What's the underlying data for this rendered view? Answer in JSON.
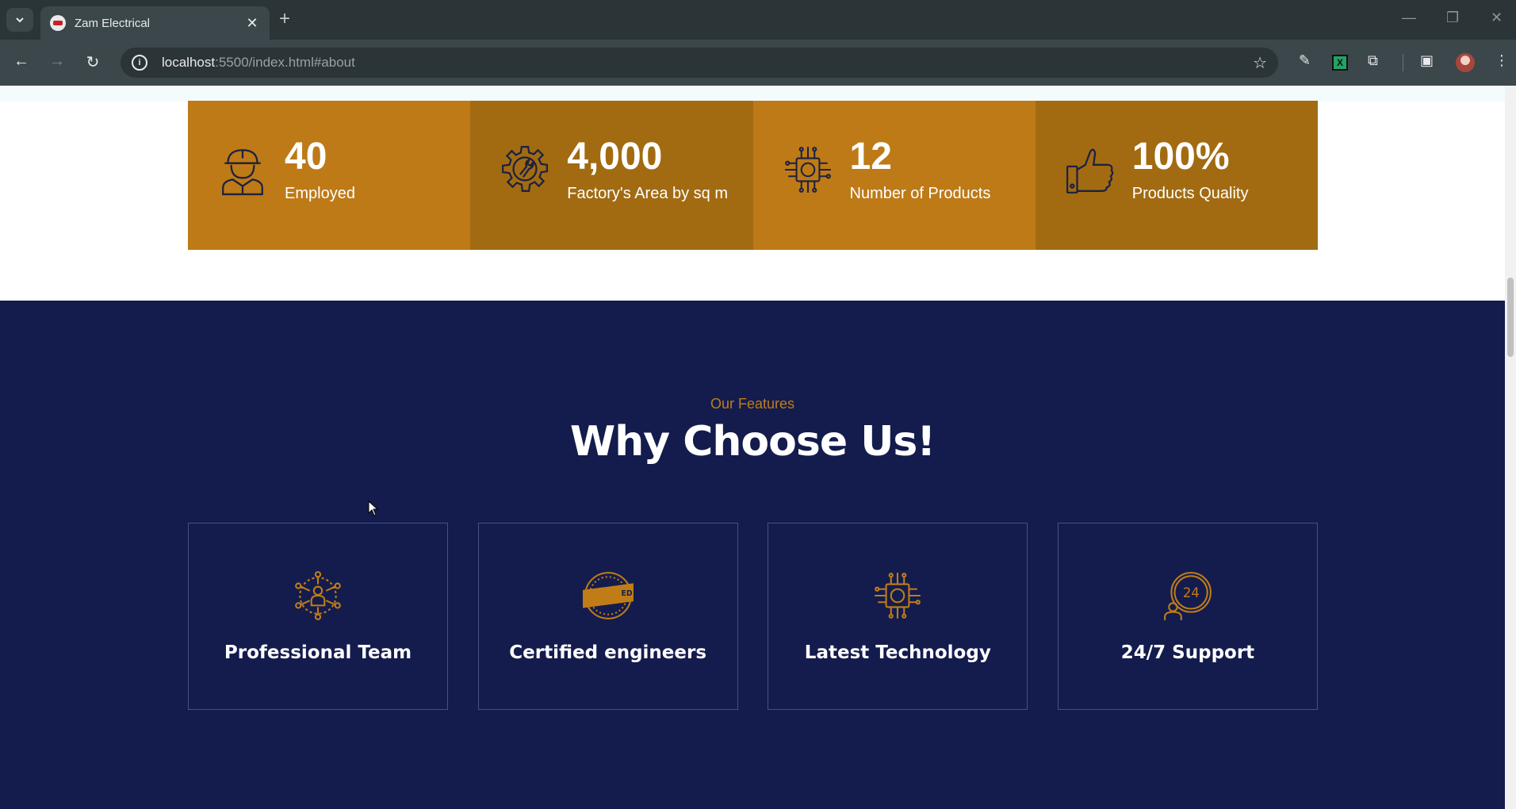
{
  "browser": {
    "tab_title": "Zam Electrical",
    "url_host": "localhost",
    "url_rest": ":5500/index.html#about"
  },
  "stats": [
    {
      "value": "40",
      "label": "Employed",
      "icon": "worker-icon"
    },
    {
      "value": "4,000",
      "label": "Factory's Area by sq m",
      "icon": "gear-wrench-icon"
    },
    {
      "value": "12",
      "label": "Number of Products",
      "icon": "chip-icon"
    },
    {
      "value": "100%",
      "label": "Products Quality",
      "icon": "thumbs-up-icon"
    }
  ],
  "features": {
    "eyebrow": "Our Features",
    "heading": "Why Choose Us!",
    "cards": [
      {
        "title": "Professional Team",
        "icon": "team-network-icon"
      },
      {
        "title": "Certified engineers",
        "icon": "certified-badge-icon"
      },
      {
        "title": "Latest Technology",
        "icon": "chip-icon"
      },
      {
        "title": "24/7 Support",
        "icon": "support-24-icon"
      }
    ]
  },
  "colors": {
    "stat_light": "#be7a17",
    "stat_dark": "#a26b12",
    "features_bg": "#141c4d",
    "accent": "#c07d17"
  }
}
